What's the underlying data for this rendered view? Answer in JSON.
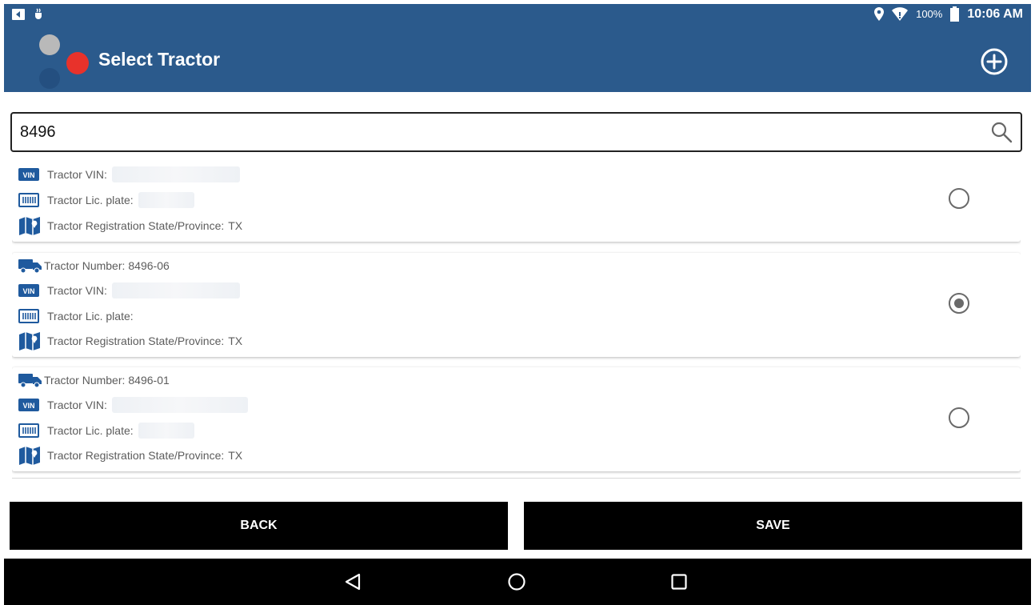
{
  "status_bar": {
    "battery_percent": "100%",
    "time": "10:06 AM"
  },
  "app_bar": {
    "title": "Select Tractor"
  },
  "search": {
    "value": "8496"
  },
  "tractors": [
    {
      "number_label": "",
      "number_value": "",
      "vin_label": "Tractor VIN:",
      "lic_plate_label": "Tractor Lic. plate:",
      "state_label": "Tractor Registration State/Province:",
      "state_value": "TX",
      "selected": false
    },
    {
      "number_label": "Tractor Number:",
      "number_value": "8496-06",
      "vin_label": "Tractor VIN:",
      "lic_plate_label": "Tractor Lic. plate:",
      "state_label": "Tractor Registration State/Province:",
      "state_value": "TX",
      "selected": true
    },
    {
      "number_label": "Tractor Number:",
      "number_value": "8496-01",
      "vin_label": "Tractor VIN:",
      "lic_plate_label": "Tractor Lic. plate:",
      "state_label": "Tractor Registration State/Province:",
      "state_value": "TX",
      "selected": false
    }
  ],
  "buttons": {
    "back": "BACK",
    "save": "SAVE"
  },
  "colors": {
    "app_bar": "#2b5a8c",
    "accent_red": "#e8322b",
    "icon_blue": "#1f5a9e",
    "button_bg": "#000000"
  }
}
